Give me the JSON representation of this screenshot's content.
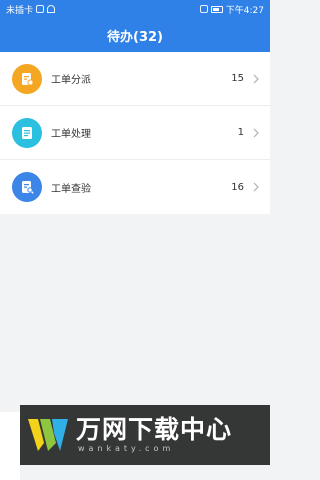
{
  "status_bar": {
    "carrier": "未插卡",
    "time": "下午4:27"
  },
  "header": {
    "title": "待办(32)"
  },
  "items": [
    {
      "label": "工单分派",
      "count": "15",
      "icon": "dispatch-icon",
      "color": "#f5a623"
    },
    {
      "label": "工单处理",
      "count": "1",
      "icon": "process-icon",
      "color": "#2bbfe0"
    },
    {
      "label": "工单查验",
      "count": "16",
      "icon": "inspect-icon",
      "color": "#3c86e8"
    }
  ],
  "watermark": {
    "title": "万网下载中心",
    "url": "wankaty.com"
  }
}
